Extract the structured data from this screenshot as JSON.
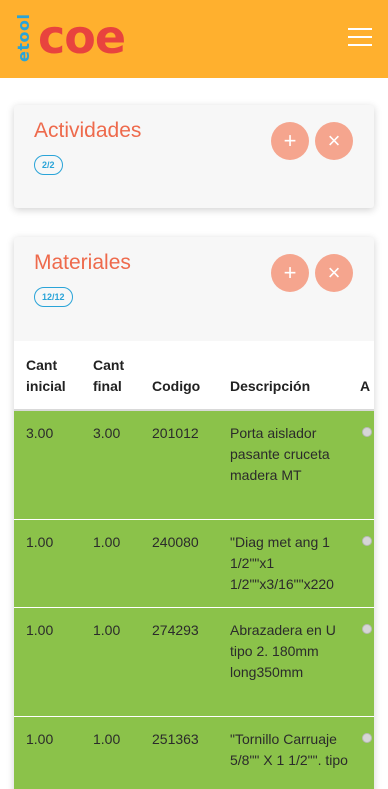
{
  "header": {
    "logo_small": "etool",
    "logo_big": "coe",
    "colors": {
      "bar": "#ffb02e",
      "logo_small": "#2aa4d8",
      "logo_big": "#e8433e"
    }
  },
  "actividades": {
    "title": "Actividades",
    "badge": "2/2"
  },
  "materiales": {
    "title": "Materiales",
    "badge": "12/12",
    "headers": {
      "cant_inicial": "Cant inicial",
      "cant_final": "Cant final",
      "codigo": "Codigo",
      "descripcion": "Descripción",
      "a": "A"
    },
    "rows": [
      {
        "cant_inicial": "3.00",
        "cant_final": "3.00",
        "codigo": "201012",
        "descripcion": "Porta aislador pasante cruceta madera MT"
      },
      {
        "cant_inicial": "1.00",
        "cant_final": "1.00",
        "codigo": "240080",
        "descripcion": "\"Diag met ang 1 1/2\"\"x1 1/2\"\"x3/16\"\"x220"
      },
      {
        "cant_inicial": "1.00",
        "cant_final": "1.00",
        "codigo": "274293",
        "descripcion": "Abrazadera en U tipo 2. 180mm long350mm"
      },
      {
        "cant_inicial": "1.00",
        "cant_final": "1.00",
        "codigo": "251363",
        "descripcion": "\"Tornillo Carruaje 5/8\"\" X 1 1/2\"\". tipo"
      }
    ]
  },
  "icons": {
    "menu": "hamburger-icon",
    "add": "plus-icon",
    "close": "close-icon"
  },
  "accent_colors": {
    "title": "#ee6a4c",
    "row_bg": "#8bc24a",
    "button_bg": "#f5a58e",
    "badge": "#2aa4d8"
  }
}
